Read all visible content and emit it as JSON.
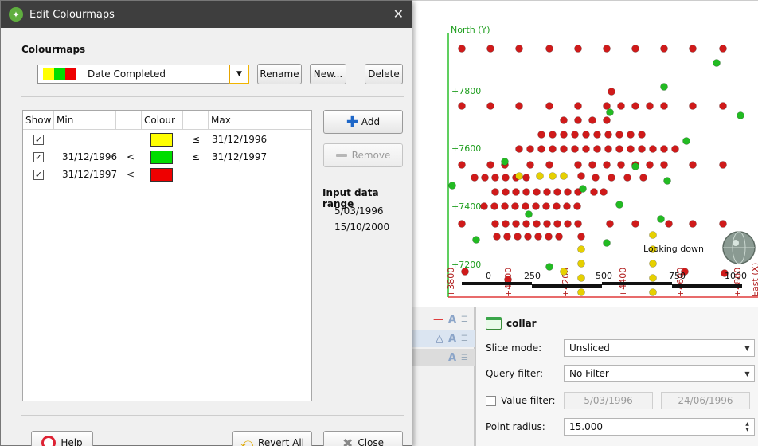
{
  "dialog": {
    "title": "Edit Colourmaps",
    "group_title": "Colourmaps",
    "colourmap_selected": "Date Completed",
    "swatch_colors": [
      "#ffff00",
      "#00dd00",
      "#ee0000"
    ],
    "buttons": {
      "rename": "Rename",
      "new": "New...",
      "delete": "Delete",
      "add": "Add",
      "remove": "Remove",
      "help": "Help",
      "revert_all": "Revert All",
      "close": "Close"
    },
    "table": {
      "headers": {
        "show": "Show",
        "min": "Min",
        "colour": "Colour",
        "max": "Max"
      },
      "rows": [
        {
          "show": true,
          "min": "",
          "min_op": "",
          "colour": "#ffff00",
          "max_op": "≤",
          "max": "31/12/1996"
        },
        {
          "show": true,
          "min": "31/12/1996",
          "min_op": "<",
          "colour": "#00dd00",
          "max_op": "≤",
          "max": "31/12/1997"
        },
        {
          "show": true,
          "min": "31/12/1997",
          "min_op": "<",
          "colour": "#ee0000",
          "max_op": "",
          "max": ""
        }
      ]
    },
    "input_range": {
      "title": "Input data range",
      "min": "5/03/1996",
      "max": "15/10/2000"
    }
  },
  "scene": {
    "north_label": "North (Y)",
    "y_ticks": [
      "+7800",
      "+7600",
      "+7400",
      "+7200"
    ],
    "x_ticks": [
      "+3800",
      "+4000",
      "+4200",
      "+4400",
      "+4600",
      "+4800"
    ],
    "scale_labels": [
      "0",
      "250",
      "500",
      "750",
      "1000"
    ],
    "looking_label": "Looking down",
    "east_label": "East (X)"
  },
  "properties": {
    "title": "collar",
    "slice_mode_label": "Slice mode:",
    "slice_mode_value": "Unsliced",
    "query_filter_label": "Query filter:",
    "query_filter_value": "No Filter",
    "value_filter_label": "Value filter:",
    "value_filter_min": "5/03/1996",
    "value_filter_max": "24/06/1996",
    "point_radius_label": "Point radius:",
    "point_radius_value": "15.000"
  }
}
